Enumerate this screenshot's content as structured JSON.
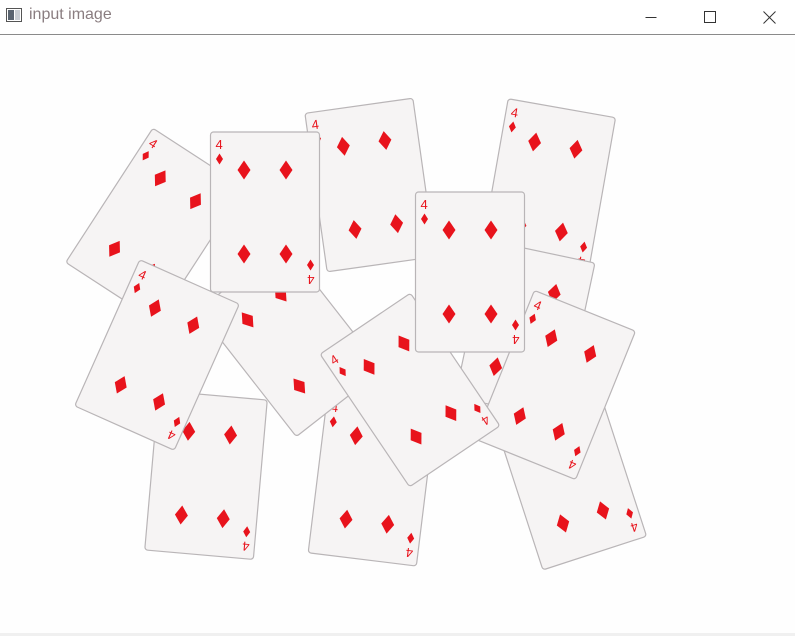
{
  "window": {
    "title": "input image",
    "controls": {
      "minimize_icon": "minimize-icon",
      "maximize_icon": "maximize-icon",
      "close_icon": "close-icon"
    }
  },
  "image": {
    "description_colors": {
      "card_face": "#f6f4f4",
      "card_border": "#b9b5b7",
      "suit": "#e8131c"
    },
    "cards": [
      {
        "rank": "4",
        "suit": "diamonds"
      },
      {
        "rank": "4",
        "suit": "diamonds"
      },
      {
        "rank": "4",
        "suit": "diamonds"
      },
      {
        "rank": "4",
        "suit": "diamonds"
      },
      {
        "rank": "4",
        "suit": "diamonds"
      },
      {
        "rank": "4",
        "suit": "diamonds"
      },
      {
        "rank": "4",
        "suit": "diamonds"
      },
      {
        "rank": "4",
        "suit": "diamonds"
      },
      {
        "rank": "4",
        "suit": "diamonds"
      },
      {
        "rank": "4",
        "suit": "diamonds"
      },
      {
        "rank": "4",
        "suit": "diamonds"
      },
      {
        "rank": "4",
        "suit": "diamonds"
      },
      {
        "rank": "4",
        "suit": "diamonds"
      },
      {
        "rank": "4",
        "suit": "diamonds"
      }
    ]
  }
}
